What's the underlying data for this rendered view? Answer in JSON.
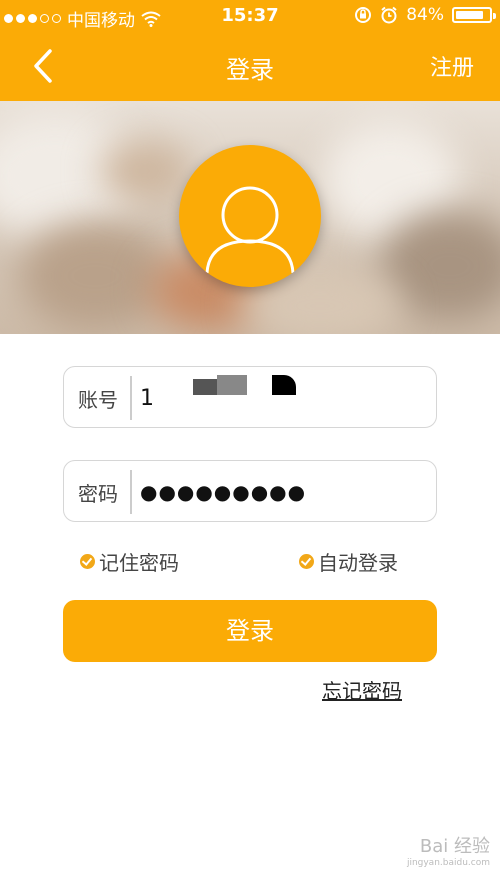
{
  "status_bar": {
    "carrier": "中国移动",
    "time": "15:37",
    "battery": "84%",
    "battery_level": 0.84
  },
  "nav": {
    "title": "登录",
    "register": "注册"
  },
  "form": {
    "account_label": "账号",
    "account_value": "1",
    "password_label": "密码",
    "password_value": "●●●●●●●●●"
  },
  "options": {
    "remember_password": "记住密码",
    "auto_login": "自动登录"
  },
  "login_button": "登录",
  "forgot_password": "忘记密码",
  "watermark": {
    "text": "Bai 经验",
    "sub": "jingyan.baidu.com"
  },
  "colors": {
    "accent": "#fbab06"
  }
}
